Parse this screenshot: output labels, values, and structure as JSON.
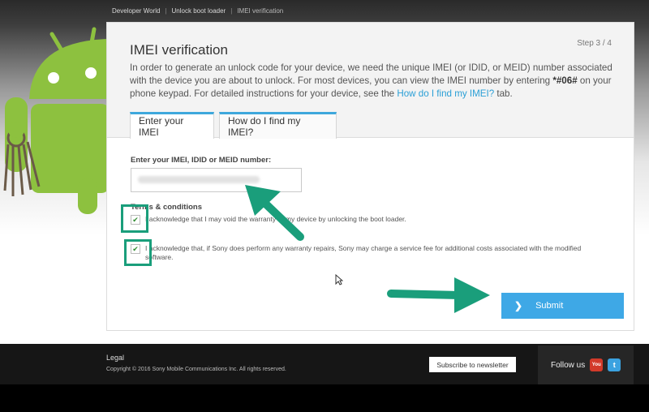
{
  "breadcrumb": {
    "items": [
      "Developer World",
      "Unlock boot loader",
      "IMEI verification"
    ]
  },
  "panel": {
    "title": "IMEI verification",
    "step": "Step 3 / 4",
    "intro_part1": "In order to generate an unlock code for your device, we need the unique IMEI (or IDID, or MEID) number associated with the device you are about to unlock. For most devices, you can view the IMEI number by entering ",
    "intro_code": "*#06#",
    "intro_part2": " on your phone keypad. For detailed instructions for your device, see the ",
    "intro_link": "How do I find my IMEI?",
    "intro_part3": " tab."
  },
  "tabs": [
    {
      "label": "Enter your IMEI",
      "active": true
    },
    {
      "label": "How do I find my IMEI?",
      "active": false
    }
  ],
  "form": {
    "imei_label": "Enter your IMEI, IDID or MEID number:",
    "imei_value": "",
    "terms_title": "Terms & conditions",
    "terms": [
      {
        "checked": true,
        "text": "I acknowledge that I may void the warranty of my device by unlocking the boot loader."
      },
      {
        "checked": true,
        "text": "I acknowledge that, if Sony does perform any warranty repairs, Sony may charge a service fee for additional costs associated with the modified software."
      }
    ],
    "submit_label": "Submit",
    "check_glyph": "✔"
  },
  "footer": {
    "legal": "Legal",
    "copyright": "Copyright © 2016 Sony Mobile Communications Inc. All rights reserved.",
    "newsletter": "Subscribe to newsletter",
    "follow": "Follow us",
    "youtube": "You",
    "twitter": "t"
  },
  "colors": {
    "accent": "#3ea8e6",
    "annotation": "#1a9e7b",
    "android": "#8dc13f"
  },
  "icons": [
    "android-mascot-icon",
    "check-icon",
    "arrow-annotation-icon",
    "chevron-right-icon",
    "youtube-icon",
    "twitter-icon",
    "cursor-icon"
  ]
}
